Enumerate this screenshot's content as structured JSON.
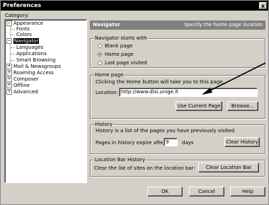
{
  "window": {
    "title": "Preferences",
    "close_glyph": "x"
  },
  "category_label": "Category:",
  "tree": {
    "appearance": "Appearance",
    "fonts": "Fonts",
    "colors": "Colors",
    "navigator": "Navigator",
    "languages": "Languages",
    "applications": "Applications",
    "smart_browsing": "Smart Browsing",
    "mail": "Mail & Newsgroups",
    "roaming": "Roaming Access",
    "composer": "Composer",
    "offline": "Offline",
    "advanced": "Advanced",
    "expanded_glyph": "−",
    "collapsed_glyph": "+"
  },
  "header": {
    "title": "Navigator",
    "subtitle": "Specify the home page location"
  },
  "starts_with": {
    "legend": "Navigator starts with",
    "options": [
      "Blank page",
      "Home page",
      "Last page visited"
    ],
    "selected_index": 1
  },
  "home_page": {
    "legend": "Home page",
    "description": "Clicking the Home button will take you to this page.",
    "location_label": "Location:",
    "location_value": "http://www.disi.unige.it",
    "use_current": "Use Current Page",
    "browse": "Browse..."
  },
  "history": {
    "legend": "History",
    "description": "History is a list of the pages you have previously visited.",
    "expire_label": "Pages in history expire after:",
    "expire_value": "9",
    "days": "days",
    "clear": "Clear History"
  },
  "location_bar": {
    "legend": "Location Bar History",
    "description": "Clear the list of sites on the location bar:",
    "clear": "Clear Location Bar"
  },
  "footer": {
    "ok": "OK",
    "cancel": "Cancel",
    "help": "Help"
  }
}
